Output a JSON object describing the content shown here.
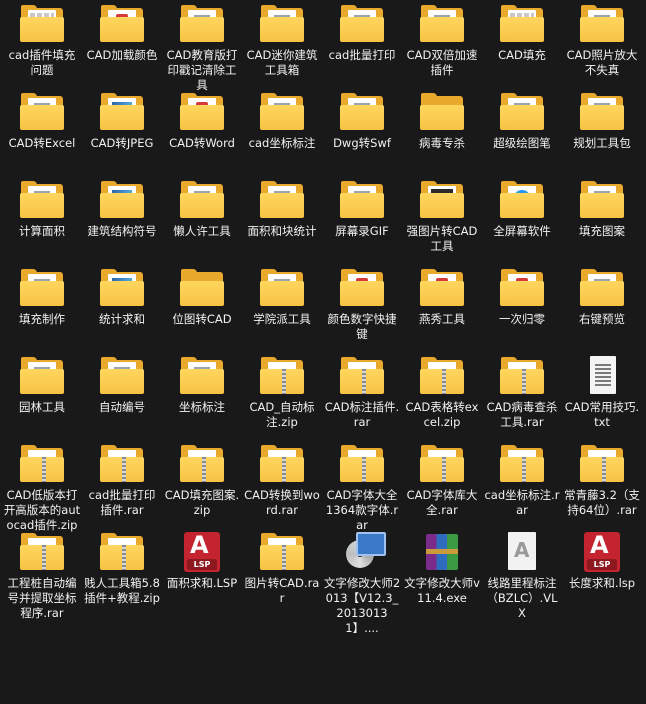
{
  "items": [
    {
      "label": "cad插件填充问题",
      "icon": "folder-icon",
      "style": "strip"
    },
    {
      "label": "CAD加载颜色",
      "icon": "folder-icon",
      "style": "mini"
    },
    {
      "label": "CAD教育版打印戳记清除工具",
      "icon": "folder-icon",
      "style": "doc"
    },
    {
      "label": "CAD迷你建筑工具箱",
      "icon": "folder-icon",
      "style": "doc"
    },
    {
      "label": "cad批量打印",
      "icon": "folder-icon",
      "style": "doc"
    },
    {
      "label": "CAD双倍加速插件",
      "icon": "folder-icon",
      "style": "doc"
    },
    {
      "label": "CAD填充",
      "icon": "folder-icon",
      "style": "strip"
    },
    {
      "label": "CAD照片放大不失真",
      "icon": "folder-icon",
      "style": "doc"
    },
    {
      "label": "CAD转Excel",
      "icon": "folder-icon",
      "style": "doc"
    },
    {
      "label": "CAD转JPEG",
      "icon": "folder-icon",
      "style": "pic"
    },
    {
      "label": "CAD转Word",
      "icon": "folder-icon",
      "style": "mini"
    },
    {
      "label": "cad坐标标注",
      "icon": "folder-icon",
      "style": "doc"
    },
    {
      "label": "Dwg转Swf",
      "icon": "folder-icon",
      "style": "doc"
    },
    {
      "label": "病毒专杀",
      "icon": "folder-icon",
      "style": "plain"
    },
    {
      "label": "超级绘图笔",
      "icon": "folder-icon",
      "style": "doc"
    },
    {
      "label": "规划工具包",
      "icon": "folder-icon",
      "style": "doc"
    },
    {
      "label": "计算面积",
      "icon": "folder-icon",
      "style": "doc"
    },
    {
      "label": "建筑结构符号",
      "icon": "folder-icon",
      "style": "pic"
    },
    {
      "label": "懒人许工具",
      "icon": "folder-icon",
      "style": "doc"
    },
    {
      "label": "面积和块统计",
      "icon": "folder-icon",
      "style": "doc"
    },
    {
      "label": "屏幕录GIF",
      "icon": "folder-icon",
      "style": "doc"
    },
    {
      "label": "强图片转CAD工具",
      "icon": "folder-icon",
      "style": "dark"
    },
    {
      "label": "全屏幕软件",
      "icon": "folder-icon",
      "style": "edge"
    },
    {
      "label": "填充图案",
      "icon": "folder-icon",
      "style": "doc"
    },
    {
      "label": "填充制作",
      "icon": "folder-icon",
      "style": "doc"
    },
    {
      "label": "统计求和",
      "icon": "folder-icon",
      "style": "pic"
    },
    {
      "label": "位图转CAD",
      "icon": "folder-icon",
      "style": "plain"
    },
    {
      "label": "学院派工具",
      "icon": "folder-icon",
      "style": "doc"
    },
    {
      "label": "颜色数字快捷键",
      "icon": "folder-icon",
      "style": "mini"
    },
    {
      "label": "燕秀工具",
      "icon": "folder-icon",
      "style": "mini"
    },
    {
      "label": "一次归零",
      "icon": "folder-icon",
      "style": "mini"
    },
    {
      "label": "右键预览",
      "icon": "folder-icon",
      "style": "doc"
    },
    {
      "label": "园林工具",
      "icon": "folder-icon",
      "style": "doc"
    },
    {
      "label": "自动编号",
      "icon": "folder-icon",
      "style": "doc"
    },
    {
      "label": "坐标标注",
      "icon": "folder-icon",
      "style": "doc"
    },
    {
      "label": "CAD_自动标注.zip",
      "icon": "zip-folder-icon",
      "style": "zip"
    },
    {
      "label": "CAD标注插件.rar",
      "icon": "zip-folder-icon",
      "style": "zip"
    },
    {
      "label": "CAD表格转excel.zip",
      "icon": "zip-folder-icon",
      "style": "zip"
    },
    {
      "label": "CAD病毒查杀工具.rar",
      "icon": "zip-folder-icon",
      "style": "zip"
    },
    {
      "label": "CAD常用技巧.txt",
      "icon": "text-file-icon",
      "style": "txt"
    },
    {
      "label": "CAD低版本打开高版本的autocad插件.zip",
      "icon": "zip-folder-icon",
      "style": "zip"
    },
    {
      "label": "cad批量打印插件.rar",
      "icon": "zip-folder-icon",
      "style": "zip"
    },
    {
      "label": "CAD填充图案.zip",
      "icon": "zip-folder-icon",
      "style": "zip"
    },
    {
      "label": "CAD转换到word.rar",
      "icon": "zip-folder-icon",
      "style": "zip"
    },
    {
      "label": "CAD字体大全1364款字体.rar",
      "icon": "zip-folder-icon",
      "style": "zip"
    },
    {
      "label": "CAD字体库大全.rar",
      "icon": "zip-folder-icon",
      "style": "zip"
    },
    {
      "label": "cad坐标标注.rar",
      "icon": "zip-folder-icon",
      "style": "zip"
    },
    {
      "label": "常青藤3.2（支持64位）.rar",
      "icon": "zip-folder-icon",
      "style": "zip"
    },
    {
      "label": "工程桩自动编号并提取坐标程序.rar",
      "icon": "zip-folder-icon",
      "style": "zip"
    },
    {
      "label": "贱人工具箱5.8插件+教程.zip",
      "icon": "zip-folder-icon",
      "style": "zip"
    },
    {
      "label": "面积求和.LSP",
      "icon": "lsp-file-icon",
      "style": "lsp"
    },
    {
      "label": "图片转CAD.rar",
      "icon": "zip-folder-icon",
      "style": "zip"
    },
    {
      "label": "文字修改大师2013【V12.3_20130131】....",
      "icon": "installer-icon",
      "style": "installer"
    },
    {
      "label": "文字修改大师v11.4.exe",
      "icon": "winrar-icon",
      "style": "winrar"
    },
    {
      "label": "线路里程标注（BZLC）.VLX",
      "icon": "vlx-file-icon",
      "style": "vlx"
    },
    {
      "label": "长度求和.lsp",
      "icon": "lsp-file-icon",
      "style": "lsp"
    }
  ],
  "lsp_tag": "LSP"
}
